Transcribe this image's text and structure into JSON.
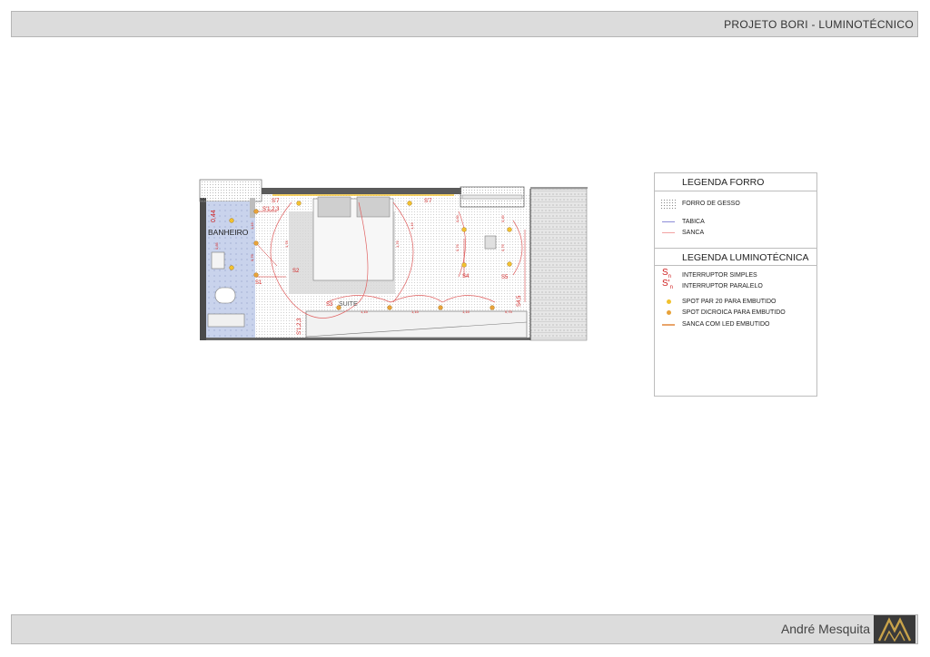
{
  "header": {
    "title": "PROJETO BORI -  LUMINOTÉCNICO"
  },
  "footer": {
    "author": "André Mesquita"
  },
  "plan": {
    "rooms": {
      "bathroom": "BANHEIRO",
      "suite": "SUITE"
    },
    "switch_labels": [
      "S'7",
      "S'1,2,3",
      "S2",
      "S1",
      "S'7",
      "S4",
      "S5",
      "S3",
      "S4,5",
      "S'1,2,3"
    ],
    "dimensions": [
      "0,44",
      "1,78",
      "1,76",
      "0,85",
      "0,76",
      "0,76",
      "0,76",
      "1,15",
      "1,15",
      "1,15",
      "0,75",
      "1,16",
      "1,16",
      "0,69",
      "0,49"
    ]
  },
  "legend": {
    "ceiling_title": "LEGENDA FORRO",
    "ceiling_items": [
      {
        "label": "FORRO DE GESSO",
        "icon": "dot-hatch-icon"
      },
      {
        "label": "TABICA",
        "icon": "blue-line-icon",
        "color": "#8c8cd8"
      },
      {
        "label": "SANCA",
        "icon": "pink-line-icon",
        "color": "#f2a2a2"
      }
    ],
    "lighting_title": "LEGENDA LUMINOTÉCNICA",
    "lighting_items": [
      {
        "label": "INTERRUPTOR SIMPLES",
        "symbol": "S",
        "sub": "n",
        "icon": "switch-simple-icon"
      },
      {
        "label": "INTERRUPTOR PARALELO",
        "symbol": "S'",
        "sub": "n",
        "icon": "switch-parallel-icon"
      },
      {
        "label": "SPOT PAR 20 PARA EMBUTIDO",
        "icon": "spot-par20-icon",
        "color": "#f2c12e"
      },
      {
        "label": "SPOT DICROICA PARA EMBUTIDO",
        "icon": "spot-dichroic-icon",
        "color": "#e8a23a"
      },
      {
        "label": "SANCA COM LED EMBUTIDO",
        "icon": "led-strip-icon",
        "color": "#e9a46a"
      }
    ]
  }
}
